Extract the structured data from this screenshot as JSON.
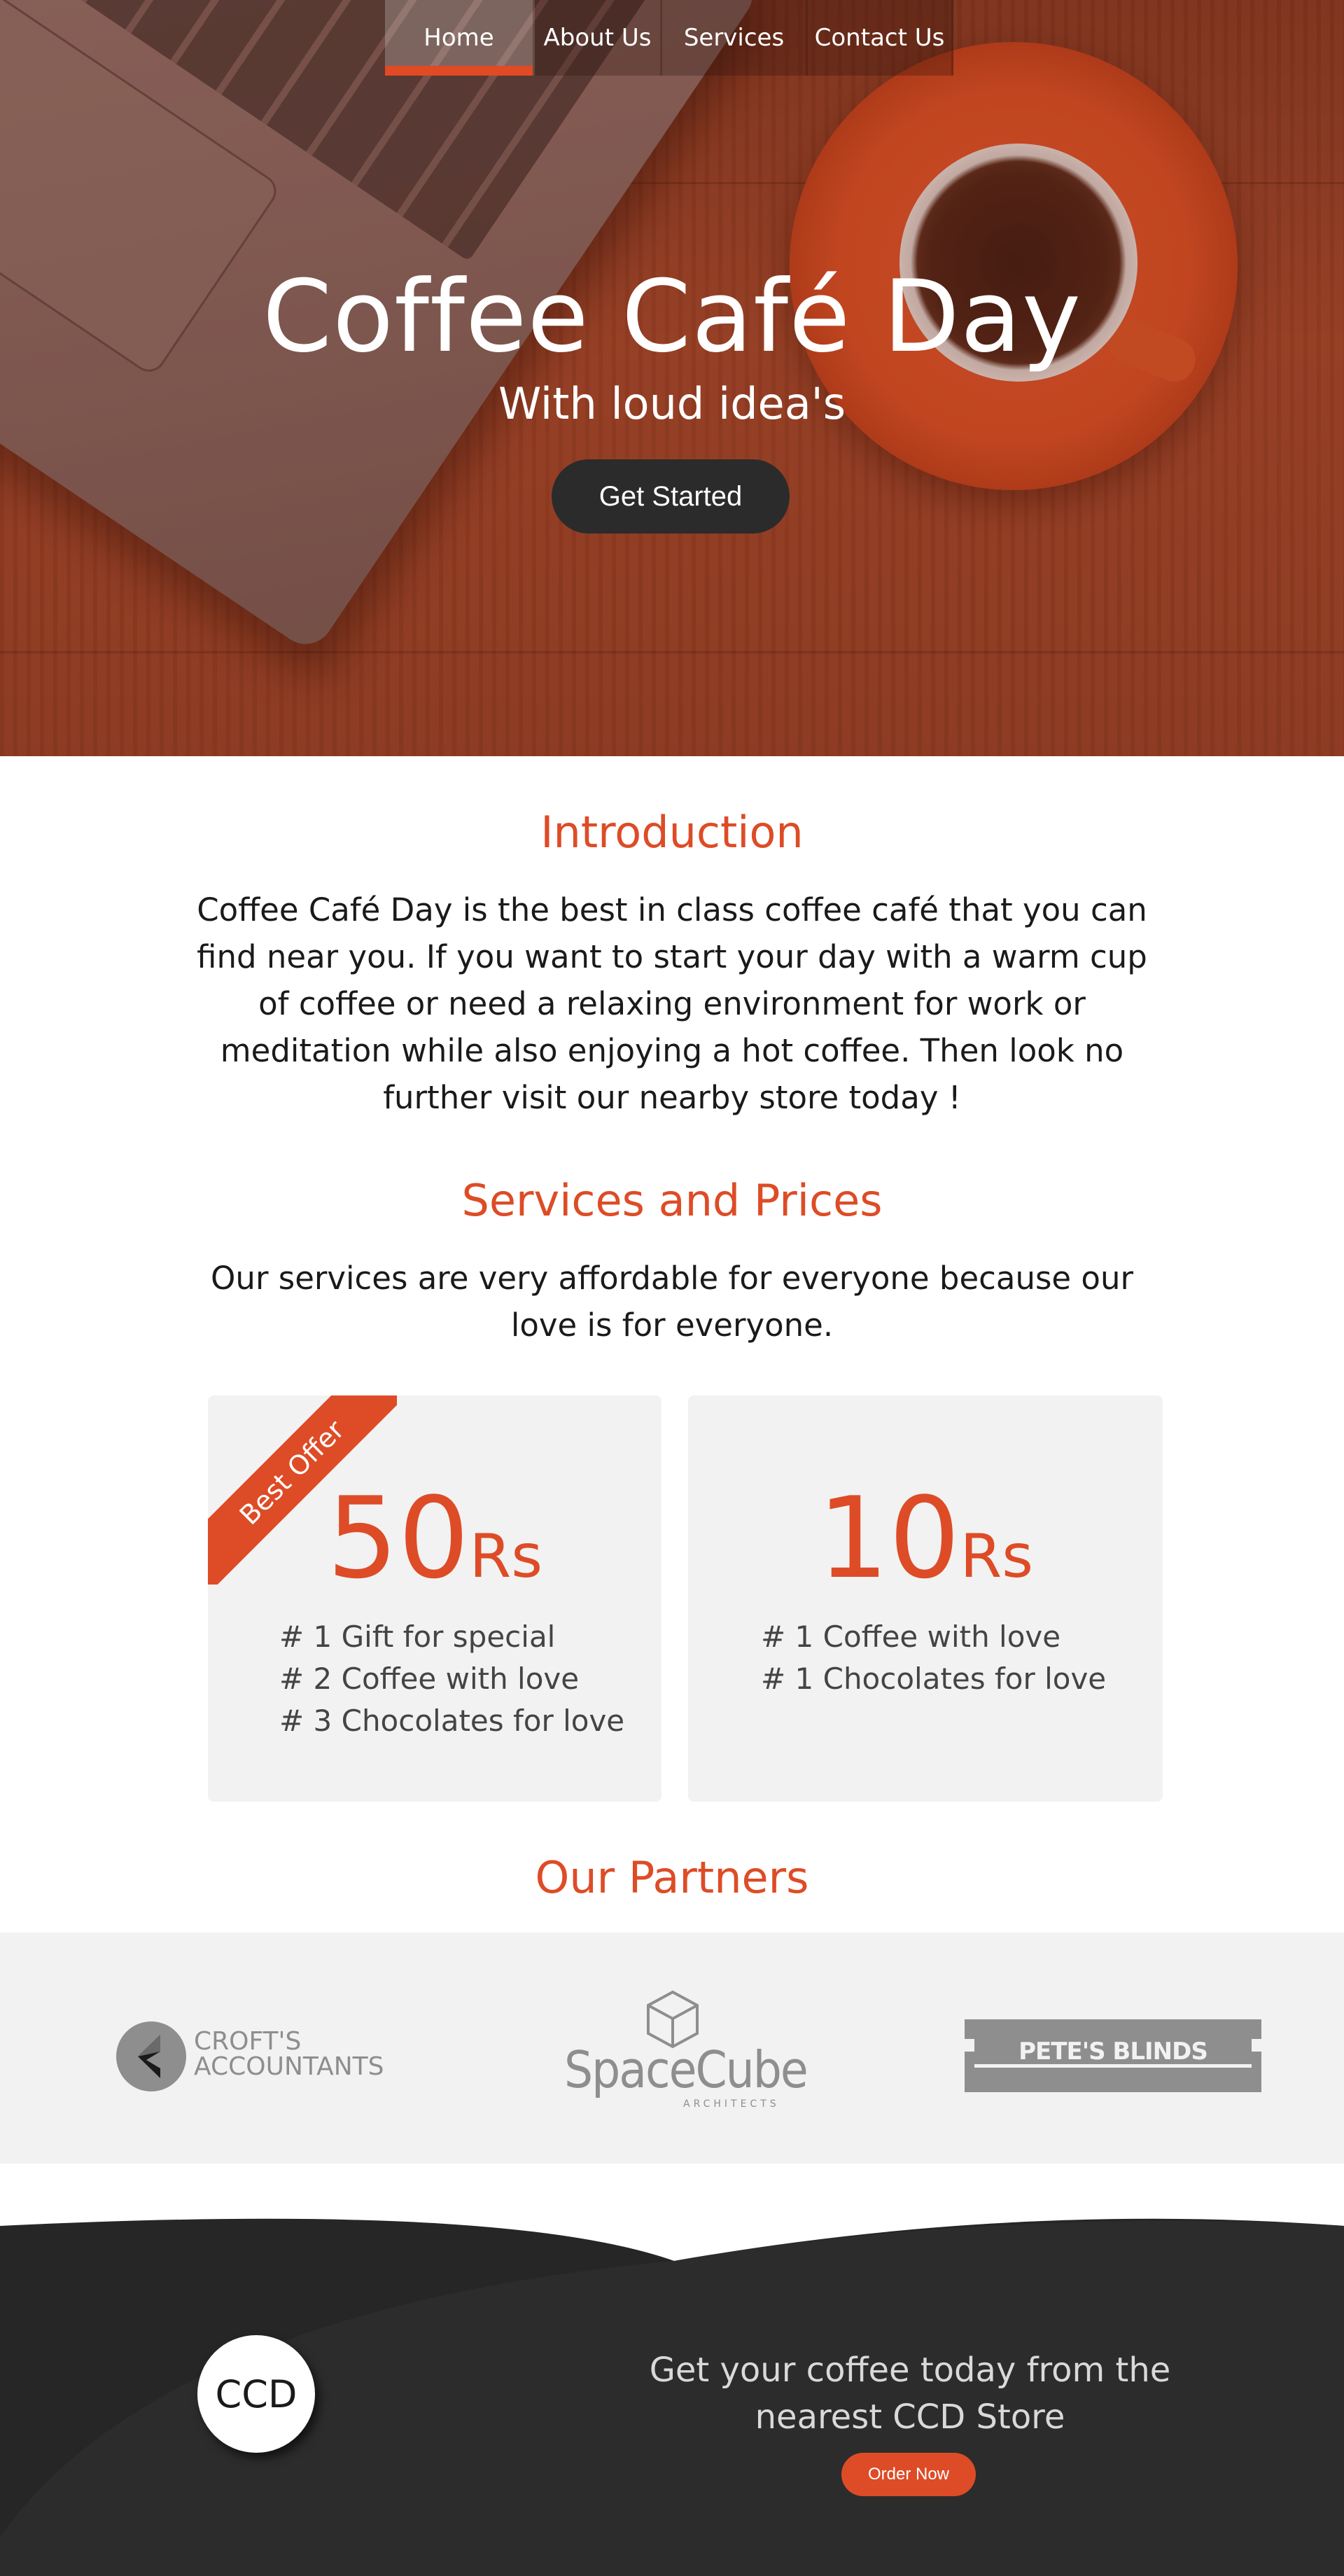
{
  "nav": {
    "items": [
      {
        "label": "Home",
        "active": true
      },
      {
        "label": "About Us",
        "active": false
      },
      {
        "label": "Services",
        "active": false
      },
      {
        "label": "Contact Us",
        "active": false
      }
    ]
  },
  "hero": {
    "title": "Coffee Café Day",
    "subtitle": "With loud idea's",
    "cta_label": "Get Started"
  },
  "introduction": {
    "heading": "Introduction",
    "text": "Coffee Café Day is the best in class coffee café that you can find near you. If you want to start your day with a warm cup of coffee or need a relaxing environment for work or meditation while also enjoying a hot coffee. Then look no further visit our nearby store today !"
  },
  "services": {
    "heading": "Services and Prices",
    "text": "Our services are very affordable for everyone because our love is for everyone.",
    "cards": [
      {
        "ribbon": "Best Offer",
        "price": "50",
        "currency": "Rs",
        "features": [
          "# 1 Gift for special",
          "# 2 Coffee with love",
          "# 3 Chocolates for love"
        ]
      },
      {
        "price": "10",
        "currency": "Rs",
        "features": [
          "# 1 Coffee with love",
          "# 1 Chocolates for love"
        ]
      }
    ]
  },
  "partners": {
    "heading": "Our Partners",
    "logos": [
      {
        "line1": "CROFT'S",
        "line2": "ACCOUNTANTS"
      },
      {
        "line1": "SpaceCube",
        "line2": "ARCHITECTS"
      },
      {
        "line1": "PETE'S BLINDS"
      }
    ]
  },
  "footer": {
    "logo_text": "CCD",
    "text": "Get your coffee today from the nearest CCD Store",
    "button_label": "Order Now"
  },
  "colors": {
    "accent": "#dd4c26",
    "dark": "#2b2b2b",
    "panel": "#f2f2f2",
    "partner_gray": "#8e8e8e"
  }
}
